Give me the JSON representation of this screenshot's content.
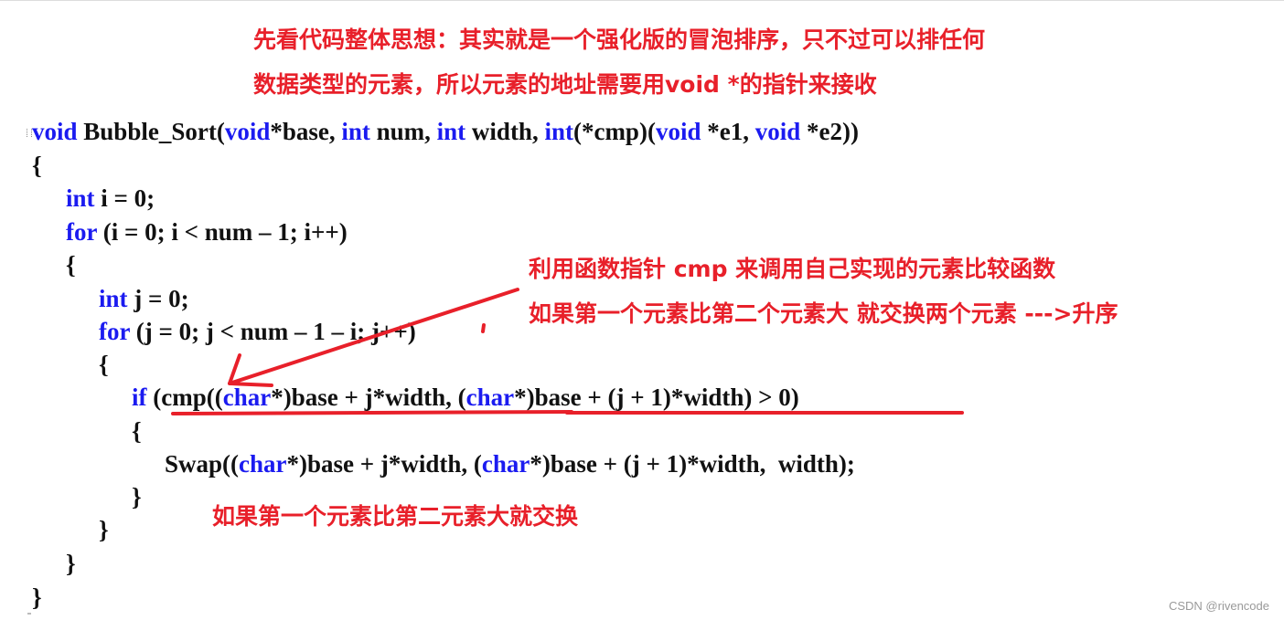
{
  "annotations": {
    "top_line1": "先看代码整体思想：其实就是一个强化版的冒泡排序，只不过可以排任何",
    "top_line2": "数据类型的元素，所以元素的地址需要用void *的指针来接收",
    "cmp_line1": "利用函数指针 cmp 来调用自己实现的元素比较函数",
    "cmp_line2": "如果第一个元素比第二个元素大 就交换两个元素 --->升序",
    "swap_note": "如果第一个元素比第二元素大就交换"
  },
  "code": {
    "l1": {
      "k1": "void",
      "t1": " Bubble_Sort(",
      "k2": "void",
      "t2": "*base, ",
      "k3": "int",
      "t3": " num, ",
      "k4": "int",
      "t4": " width, ",
      "k5": "int",
      "t5": "(*cmp)(",
      "k6": "void",
      "t6": " *e1, ",
      "k7": "void",
      "t7": " *e2))"
    },
    "l2": "{",
    "l3": {
      "k1": "int",
      "t1": " i = 0;"
    },
    "l4": {
      "k1": "for",
      "t1": " (i = 0; i < num – 1; i++)"
    },
    "l5": "{",
    "l6": {
      "k1": "int",
      "t1": " j = 0;"
    },
    "l7": {
      "k1": "for",
      "t1": " (j = 0; j < num – 1 – i; j++)"
    },
    "l8": "{",
    "l9": {
      "k1": "if",
      "t1": " (cmp((",
      "k2": "char",
      "t2": "*)base + j*width, (",
      "k3": "char",
      "t3": "*)base + (j + 1)*width) > 0)"
    },
    "l10": "{",
    "l11": {
      "t0": "Swap((",
      "k1": "char",
      "t1": "*)base + j*width, (",
      "k2": "char",
      "t2": "*)base + (j + 1)*width,  width);"
    },
    "l12": "}",
    "l13": "}",
    "l14": "}",
    "l15": "}"
  },
  "colors": {
    "annotation": "#e8202a",
    "keyword": "#1b1bf0",
    "code_text": "#111111"
  },
  "watermark": "CSDN @rivencode"
}
